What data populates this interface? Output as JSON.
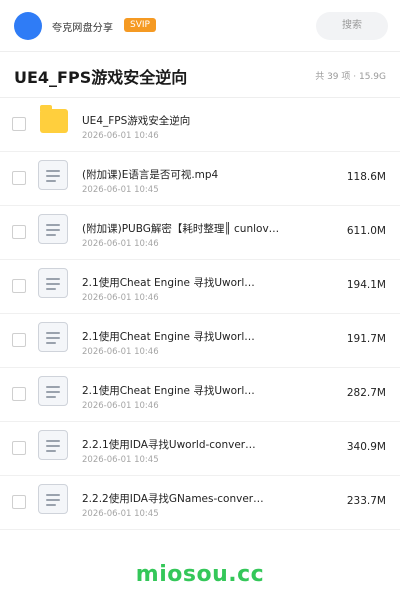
{
  "header": {
    "brand": "夸克网盘分享",
    "badge": "SVIP",
    "search_label": "搜索"
  },
  "colors": {
    "avatar": "#2f7cf6",
    "badge": "#f59a23",
    "folder": "#ffcf3d",
    "watermark": "#34c759"
  },
  "title_row": {
    "title": "UE4_FPS游戏安全逆向",
    "summary": "共 39 项 · 15.9G"
  },
  "items": [
    {
      "type": "folder",
      "icon": "folder-icon",
      "name": "UE4_FPS游戏安全逆向",
      "date": "2026-06-01 10:46",
      "size": ""
    },
    {
      "type": "file",
      "icon": "file-icon",
      "name": "(附加课)E语言是否可视.mp4",
      "date": "2026-06-01 10:45",
      "size": "118.6M"
    },
    {
      "type": "file",
      "icon": "file-icon",
      "name": "(附加课)PUBG解密【耗时整理║ cunlove…",
      "date": "2026-06-01 10:46",
      "size": "611.0M"
    },
    {
      "type": "file",
      "icon": "file-icon",
      "name": "2.1使用Cheat Engine 寻找Uworl…",
      "date": "2026-06-01 10:46",
      "size": "194.1M"
    },
    {
      "type": "file",
      "icon": "file-icon",
      "name": "2.1使用Cheat Engine 寻找Uworl…",
      "date": "2026-06-01 10:46",
      "size": "191.7M"
    },
    {
      "type": "file",
      "icon": "file-icon",
      "name": "2.1使用Cheat Engine 寻找Uworl…",
      "date": "2026-06-01 10:46",
      "size": "282.7M"
    },
    {
      "type": "file",
      "icon": "file-icon",
      "name": "2.2.1使用IDA寻找Uworld-conver…",
      "date": "2026-06-01 10:45",
      "size": "340.9M"
    },
    {
      "type": "file",
      "icon": "file-icon",
      "name": "2.2.2使用IDA寻找GNames-conver…",
      "date": "2026-06-01 10:45",
      "size": "233.7M"
    }
  ],
  "watermark": "miosou.cc"
}
